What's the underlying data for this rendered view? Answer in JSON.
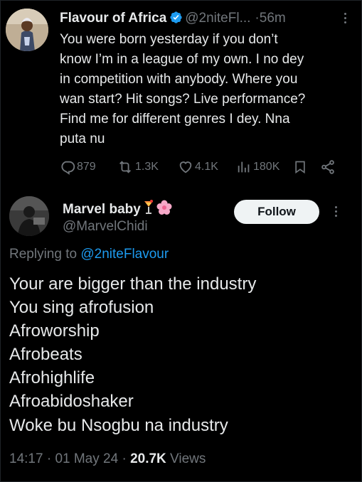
{
  "colors": {
    "background": "#000000",
    "text_primary": "#e7e9ea",
    "text_secondary": "#71767b",
    "link": "#1d9bf0",
    "verified": "#1d9bf0",
    "follow_button_bg": "#eff3f4",
    "follow_button_text": "#0f1419"
  },
  "tweet": {
    "author_name": "Flavour of Africa",
    "verified_icon": "verified-badge-icon",
    "handle": "@2niteFl...",
    "separator": "·",
    "time": "56m",
    "body": "You were born yesterday if you don’t\nknow I’m in a league of my own. I no dey\nin competition with anybody. Where you\nwan start? Hit songs? Live performance?\nFind me for different genres I dey.  Nna\nputa nu",
    "stats": {
      "replies": "879",
      "reposts": "1.3K",
      "likes": "4.1K",
      "views": "180K"
    },
    "icons": [
      "reply-icon",
      "repost-icon",
      "like-icon",
      "views-icon",
      "bookmark-icon",
      "share-icon"
    ]
  },
  "reply": {
    "author_name": "Marvel baby",
    "emoji_icons": [
      "tropical-drink-emoji",
      "cherry-blossom-emoji"
    ],
    "handle": "@MarvelChidi",
    "follow_label": "Follow",
    "replying_prefix": "Replying to",
    "replying_to": "@2niteFlavour",
    "lines": [
      "Your are bigger than the industry",
      "You sing afrofusion",
      "Afroworship",
      "Afrobeats",
      "Afrohighlife",
      "Afroabidoshaker",
      "Woke bu Nsogbu na industry"
    ],
    "time": "14:17",
    "dot": "·",
    "date": "01 May 24",
    "views_count": "20.7K",
    "views_label": "Views"
  }
}
